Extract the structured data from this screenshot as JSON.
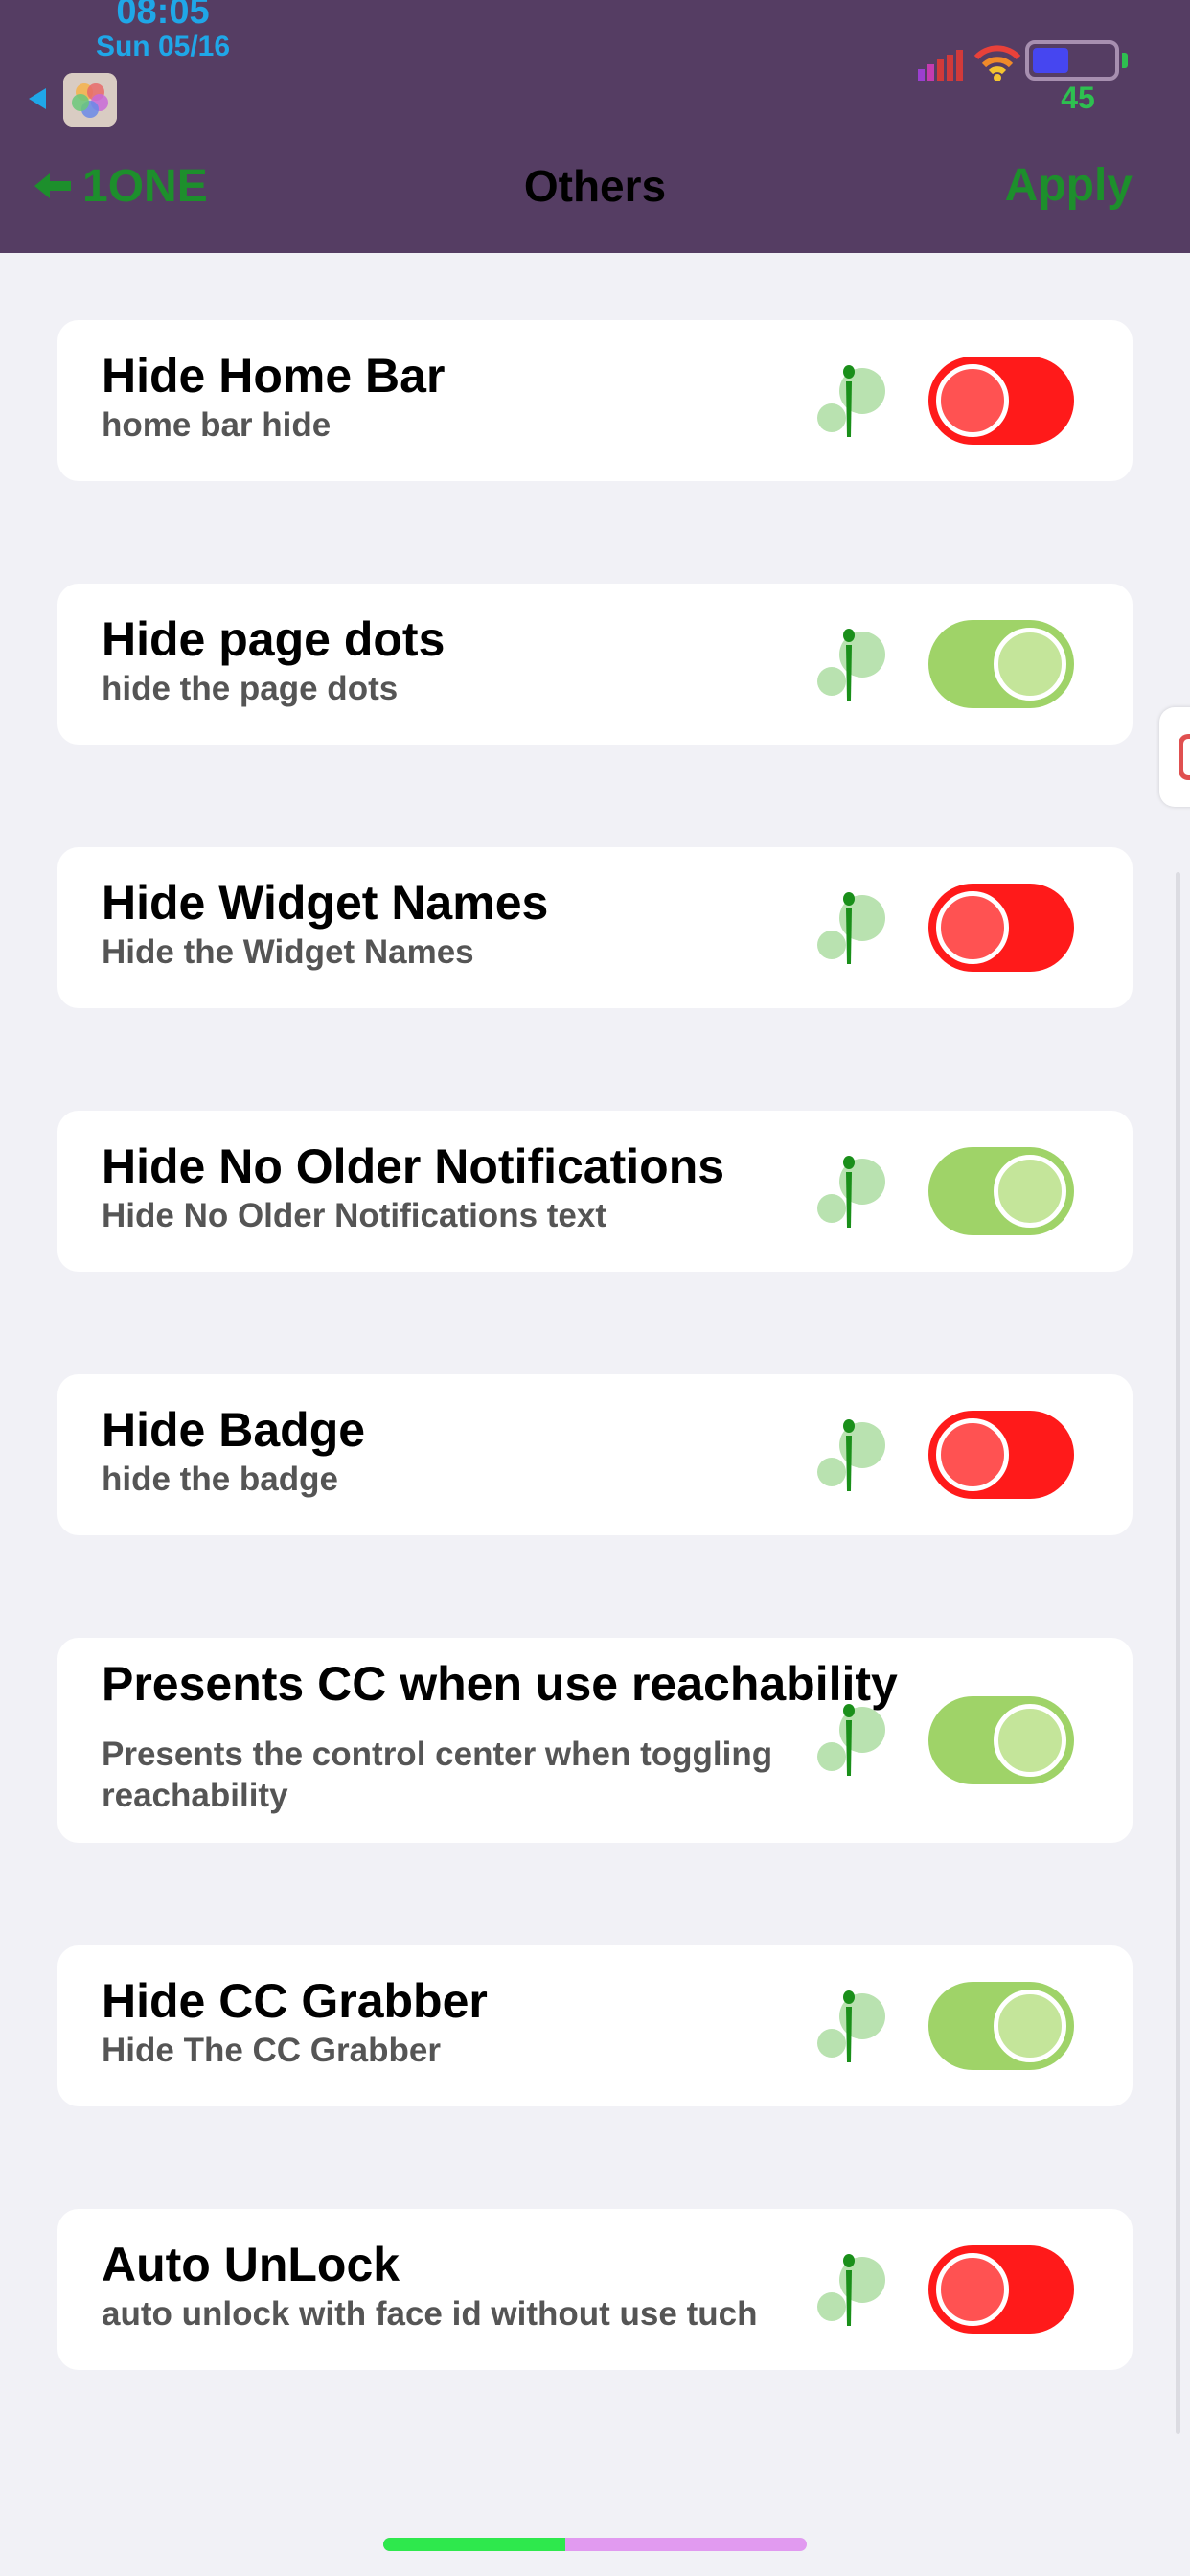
{
  "status_bar": {
    "time": "08:05",
    "date": "Sun 05/16",
    "battery_percent": "45",
    "battery_level": 0.45,
    "colors": {
      "time": "#1fa7e8",
      "battery_text": "#2ec050",
      "signal": "#d13a3a"
    }
  },
  "nav": {
    "back_label": "1ONE",
    "title": "Others",
    "apply_label": "Apply",
    "colors": {
      "background": "#553d63",
      "action": "#1d8f2c"
    }
  },
  "settings": [
    {
      "title": "Hide Home Bar",
      "subtitle": "home bar hide",
      "state": "off"
    },
    {
      "title": "Hide page dots",
      "subtitle": "hide the page dots",
      "state": "on"
    },
    {
      "title": "Hide Widget Names",
      "subtitle": "Hide the Widget Names",
      "state": "off"
    },
    {
      "title": "Hide No Older Notifications",
      "subtitle": "Hide No Older Notifications text",
      "state": "on"
    },
    {
      "title": "Hide Badge",
      "subtitle": "hide the badge",
      "state": "off"
    },
    {
      "title": "Presents CC when use reachability",
      "subtitle": "Presents the control center when toggling reachability",
      "state": "on"
    },
    {
      "title": "Hide CC Grabber",
      "subtitle": "Hide The CC Grabber",
      "state": "on"
    },
    {
      "title": "Auto UnLock",
      "subtitle": "auto unlock with face id without use tuch",
      "state": "off"
    }
  ],
  "toggle_colors": {
    "on": "#9fd368",
    "off": "#ff1a1a"
  },
  "icons": {
    "back": "back-arrow-icon",
    "app": "photos-app-icon",
    "row": "mascot-icon"
  }
}
